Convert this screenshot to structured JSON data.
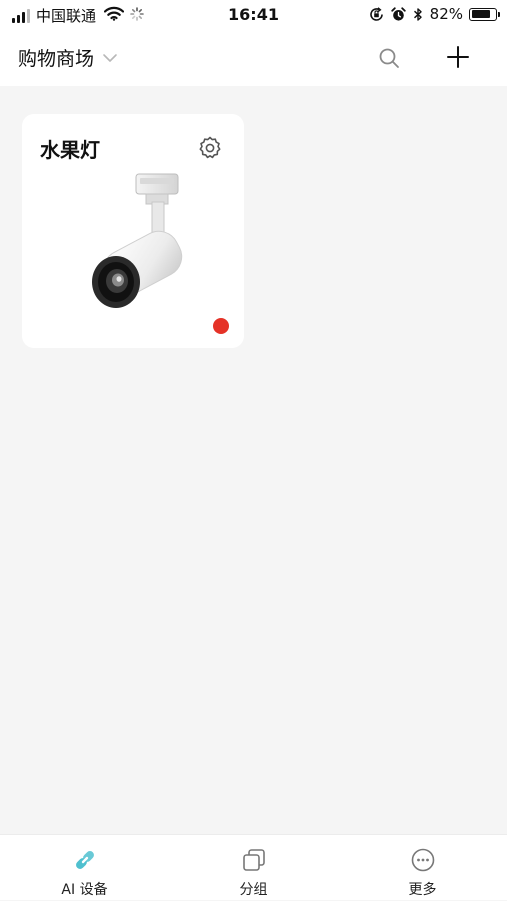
{
  "status_bar": {
    "carrier": "中国联通",
    "time": "16:41",
    "battery": "82%",
    "battery_level": 0.82,
    "icons": [
      "signal-icon",
      "wifi-icon",
      "loading-spinner-icon",
      "orientation-lock-icon",
      "alarm-icon",
      "bluetooth-icon",
      "battery-icon"
    ]
  },
  "header": {
    "title": "购物商场",
    "icons": [
      "chevron-down-icon",
      "search-icon",
      "plus-icon"
    ]
  },
  "devices": [
    {
      "name": "水果灯",
      "icon": "gear-icon",
      "image": "track-spotlight-image",
      "status_color": "#e53227"
    }
  ],
  "tabs": [
    {
      "label": "AI 设备",
      "icon": "link-icon",
      "active": true,
      "color": "#4fc0cf"
    },
    {
      "label": "分组",
      "icon": "group-icon",
      "active": false
    },
    {
      "label": "更多",
      "icon": "more-icon",
      "active": false
    }
  ],
  "colors": {
    "background": "#f5f5f5",
    "card": "#ffffff",
    "accent": "#4fc0cf",
    "status_offline": "#e53227"
  }
}
